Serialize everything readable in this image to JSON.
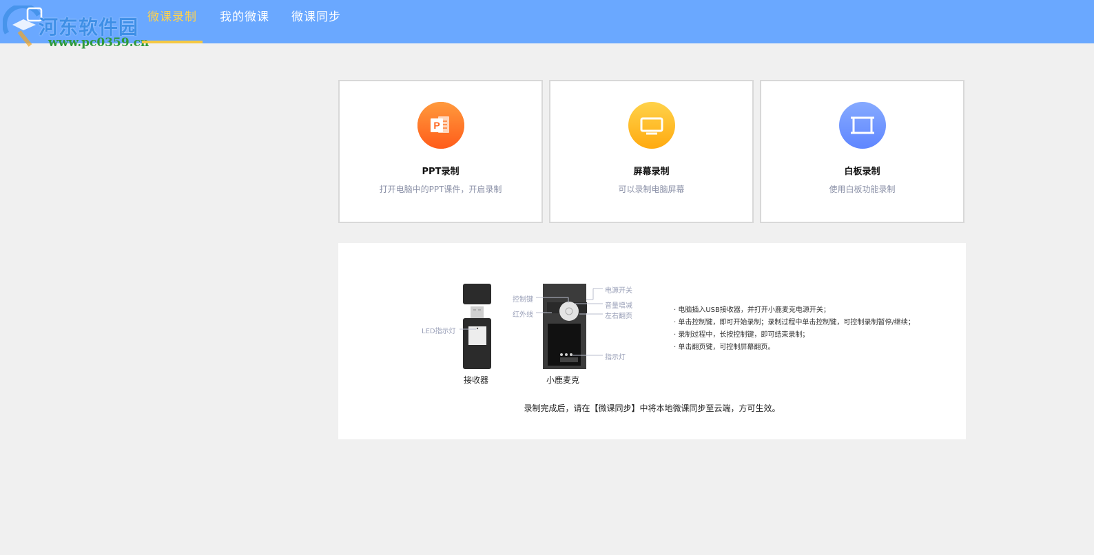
{
  "app": {
    "watermark_title": "河东软件园",
    "watermark_url": "www.pc0359.cn"
  },
  "nav": {
    "tabs": [
      {
        "label": "微课录制",
        "active": true
      },
      {
        "label": "我的微课",
        "active": false
      },
      {
        "label": "微课同步",
        "active": false
      }
    ]
  },
  "modes": [
    {
      "title": "PPT录制",
      "desc": "打开电脑中的PPT课件，开启录制",
      "icon": "ppt-icon",
      "color": "#ff7a2e"
    },
    {
      "title": "屏幕录制",
      "desc": "可以录制电脑屏幕",
      "icon": "monitor-icon",
      "color": "#ffbe26"
    },
    {
      "title": "白板录制",
      "desc": "使用白板功能录制",
      "icon": "whiteboard-icon",
      "color": "#6f98ff"
    }
  ],
  "guide": {
    "receiver_label": "接收器",
    "mic_label": "小鹿麦克",
    "callouts": {
      "led": "LED指示灯",
      "control_key": "控制键",
      "infrared": "红外线",
      "power": "电源开关",
      "volume": "音量增减",
      "page_turn": "左右翻页",
      "indicator": "指示灯"
    },
    "instructions": [
      "· 电脑插入USB接收器，并打开小鹿麦克电源开关；",
      "· 单击控制键，即可开始录制；录制过程中单击控制键，可控制录制暂停/继续；",
      "· 录制过程中，长按控制键，即可结束录制；",
      "· 单击翻页键，可控制屏幕翻页。"
    ],
    "footer": "录制完成后，请在【微课同步】中将本地微课同步至云端，方可生效。"
  }
}
